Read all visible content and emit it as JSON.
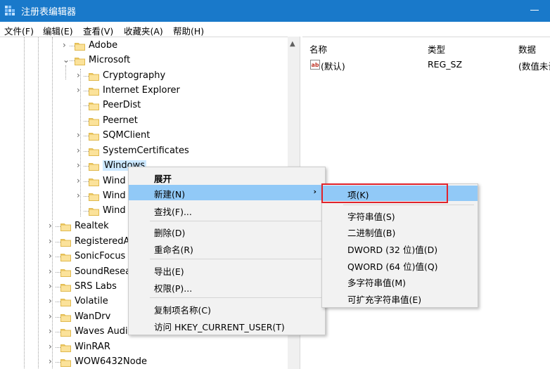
{
  "window": {
    "title": "注册表编辑器"
  },
  "menu": [
    "文件(F)",
    "编辑(E)",
    "查看(V)",
    "收藏夹(A)",
    "帮助(H)"
  ],
  "tree": {
    "items": [
      {
        "label": "Adobe",
        "expander": "›"
      },
      {
        "label": "Microsoft",
        "expander": "⌄"
      },
      {
        "label": "Cryptography",
        "expander": "›"
      },
      {
        "label": "Internet Explorer",
        "expander": "›"
      },
      {
        "label": "PeerDist",
        "expander": ""
      },
      {
        "label": "Peernet",
        "expander": ""
      },
      {
        "label": "SQMClient",
        "expander": "›"
      },
      {
        "label": "SystemCertificates",
        "expander": "›"
      },
      {
        "label": "Windows",
        "expander": "›"
      },
      {
        "label": "Wind",
        "expander": "›"
      },
      {
        "label": "Wind",
        "expander": "›"
      },
      {
        "label": "Wind",
        "expander": ""
      },
      {
        "label": "Realtek",
        "expander": "›"
      },
      {
        "label": "RegisteredA",
        "expander": "›"
      },
      {
        "label": "SonicFocus",
        "expander": "›"
      },
      {
        "label": "SoundResea",
        "expander": "›"
      },
      {
        "label": "SRS Labs",
        "expander": "›"
      },
      {
        "label": "Volatile",
        "expander": "›"
      },
      {
        "label": "WanDrv",
        "expander": "›"
      },
      {
        "label": "Waves Audi",
        "expander": "›"
      },
      {
        "label": "WinRAR",
        "expander": "›"
      },
      {
        "label": "WOW6432Node",
        "expander": "›"
      }
    ]
  },
  "list": {
    "columns": [
      "名称",
      "类型",
      "数据"
    ],
    "rows": [
      {
        "name": "(默认)",
        "type": "REG_SZ",
        "data": "(数值未设"
      }
    ]
  },
  "context_menu": {
    "items": [
      "展开",
      "新建(N)",
      "查找(F)...",
      "删除(D)",
      "重命名(R)",
      "导出(E)",
      "权限(P)...",
      "复制项名称(C)",
      "访问 HKEY_CURRENT_USER(T)"
    ]
  },
  "submenu": {
    "items": [
      "项(K)",
      "字符串值(S)",
      "二进制值(B)",
      "DWORD (32 位)值(D)",
      "QWORD (64 位)值(Q)",
      "多字符串值(M)",
      "可扩充字符串值(E)"
    ]
  },
  "colors": {
    "titlebar": "#1979ca",
    "highlight": "#91c9f7",
    "annotation": "#e1232b",
    "folder": "#f8d775"
  }
}
